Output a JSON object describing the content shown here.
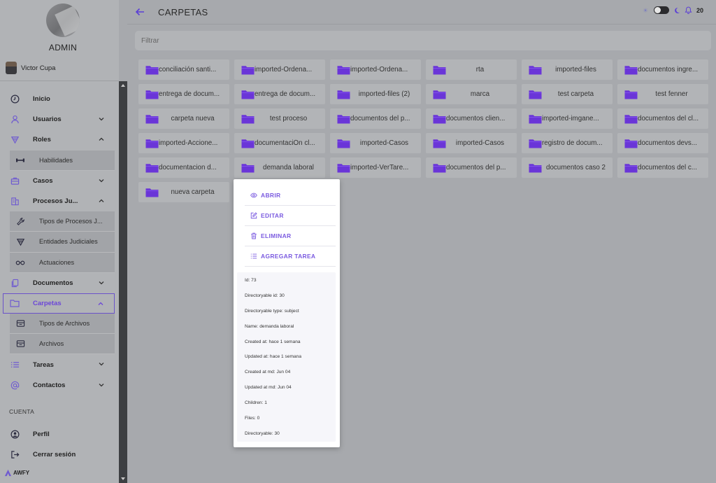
{
  "sidebar": {
    "admin_label": "ADMIN",
    "user_name": "Victor Cupa",
    "menu": [
      {
        "label": "Inicio",
        "icon": "clock-icon"
      },
      {
        "label": "Usuarios",
        "icon": "user-icon",
        "chevron": "down"
      },
      {
        "label": "Roles",
        "icon": "shield-icon",
        "chevron": "up"
      },
      {
        "label": "Habilidades",
        "icon": "dumbbell-icon",
        "sub": true
      },
      {
        "label": "Casos",
        "icon": "briefcase-icon",
        "chevron": "down"
      },
      {
        "label": "Procesos Ju...",
        "icon": "building-icon",
        "chevron": "up"
      },
      {
        "label": "Tipos de Procesos J...",
        "icon": "wrench-icon",
        "sub": true
      },
      {
        "label": "Entidades Judiciales",
        "icon": "shield-icon",
        "sub": true
      },
      {
        "label": "Actuaciones",
        "icon": "glasses-icon",
        "sub": true
      },
      {
        "label": "Documentos",
        "icon": "documents-icon",
        "chevron": "down"
      },
      {
        "label": "Carpetas",
        "icon": "folder-icon",
        "chevron": "up",
        "active": true
      },
      {
        "label": "Tipos de Archivos",
        "icon": "archive-icon",
        "sub": true
      },
      {
        "label": "Archivos",
        "icon": "archive-icon",
        "sub": true
      },
      {
        "label": "Tareas",
        "icon": "list-icon",
        "chevron": "down"
      },
      {
        "label": "Contactos",
        "icon": "at-icon",
        "chevron": "down"
      }
    ],
    "section_cuenta": "CUENTA",
    "account": [
      {
        "label": "Perfil",
        "icon": "profile-icon"
      },
      {
        "label": "Cerrar sesión",
        "icon": "logout-icon"
      }
    ],
    "logo_text": "AWFY"
  },
  "header": {
    "title": "CARPETAS",
    "notifications_count": "20"
  },
  "filter": {
    "placeholder": "Filtrar"
  },
  "folders": [
    "conciliación santi...",
    "imported-Ordena...",
    "imported-Ordena...",
    "rta",
    "imported-files",
    "documentos ingre...",
    "entrega de docum...",
    "entrega de docum...",
    "imported-files (2)",
    "marca",
    "test carpeta",
    "test fenner",
    "carpeta nueva",
    "test proceso",
    "documentos del p...",
    "documentos clien...",
    "imported-imgane...",
    "documentos del cl...",
    "imported-Accione...",
    "documentaciÓn cl...",
    "imported-Casos",
    "imported-Casos",
    "registro de docum...",
    "documentos devs...",
    "documentacion d...",
    "demanda laboral",
    "imported-VerTare...",
    "documentos del p...",
    "documentos caso 2",
    "documentos del c...",
    "nueva carpeta"
  ],
  "popup": {
    "actions": [
      {
        "label": "ABRIR",
        "icon": "eye-icon"
      },
      {
        "label": "EDITAR",
        "icon": "edit-icon"
      },
      {
        "label": "ELIMINAR",
        "icon": "trash-icon"
      },
      {
        "label": "AGREGAR TAREA",
        "icon": "list-icon"
      }
    ],
    "details": [
      "Id: 73",
      "Directoryable id: 30",
      "Directoryable type: subject",
      "Name: demanda laboral",
      "Created at: hace 1 semana",
      "Updated at: hace 1 semana",
      "Created at md: Jun 04",
      "Updated at md: Jun 04",
      "Children: 1",
      "Files: 0",
      "Directoryable: 30"
    ]
  },
  "colors": {
    "accent": "#7b5be0",
    "folder_icon": "#6a35d8",
    "active_border": "#6b52c9"
  }
}
